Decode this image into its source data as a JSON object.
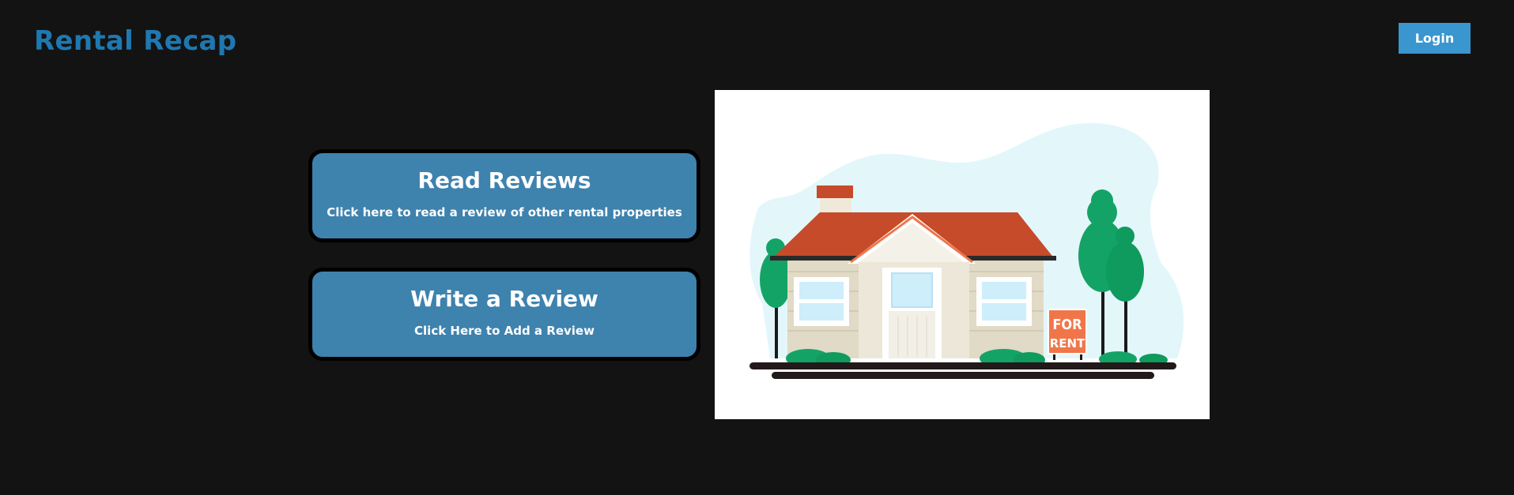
{
  "header": {
    "brand": "Rental Recap",
    "login_label": "Login"
  },
  "cards": {
    "read": {
      "title": "Read Reviews",
      "subtitle": "Click here to read a review of other rental properties"
    },
    "write": {
      "title": "Write a Review",
      "subtitle": "Click Here to Add a Review"
    }
  },
  "illustration": {
    "sign_line1": "FOR",
    "sign_line2": "RENT"
  },
  "colors": {
    "background": "#131313",
    "brand": "#1f78b0",
    "login_button": "#3a96cf",
    "card": "#3e82ae",
    "roof": "#c54b2a",
    "sign": "#f0764a",
    "trees": "#14a366"
  }
}
